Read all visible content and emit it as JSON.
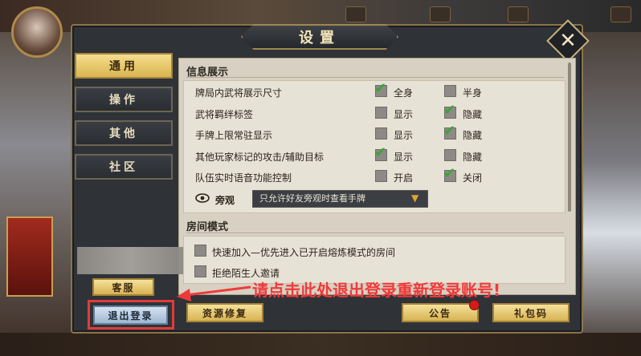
{
  "dialog": {
    "title": "设置",
    "close_label": "✕"
  },
  "tabs": [
    {
      "label": "通用",
      "active": true
    },
    {
      "label": "操作",
      "active": false
    },
    {
      "label": "其他",
      "active": false
    },
    {
      "label": "社区",
      "active": false
    }
  ],
  "info_section": {
    "header": "信息展示",
    "rows": [
      {
        "label": "牌局内武将展示尺寸",
        "opt1": "全身",
        "opt1_checked": true,
        "opt2": "半身",
        "opt2_checked": false
      },
      {
        "label": "武将羁绊标签",
        "opt1": "显示",
        "opt1_checked": false,
        "opt2": "隐藏",
        "opt2_checked": true
      },
      {
        "label": "手牌上限常驻显示",
        "opt1": "显示",
        "opt1_checked": false,
        "opt2": "隐藏",
        "opt2_checked": true
      },
      {
        "label": "其他玩家标记的攻击/辅助目标",
        "opt1": "显示",
        "opt1_checked": true,
        "opt2": "隐藏",
        "opt2_checked": false
      },
      {
        "label": "队伍实时语音功能控制",
        "opt1": "开启",
        "opt1_checked": false,
        "opt2": "关闭",
        "opt2_checked": true
      }
    ],
    "spectator_label": "旁观",
    "spectator_value": "只允许好友旁观时查看手牌"
  },
  "room_section": {
    "header": "房间模式",
    "rows": [
      {
        "label": "快速加入—优先进入已开启熔炼模式的房间",
        "checked": false
      },
      {
        "label": "拒绝陌生人邀请",
        "checked": false
      }
    ]
  },
  "buttons": {
    "customer_service": "客服",
    "logout": "退出登录",
    "resource_repair": "资源修复",
    "announcement": "公告",
    "gift_code": "礼包码"
  },
  "annotation": "请点击此处退出登录重新登录账号!",
  "colors": {
    "accent_gold": "#d9b54f",
    "annotation_red": "#f03a3a",
    "check_green": "#3ea33a"
  }
}
